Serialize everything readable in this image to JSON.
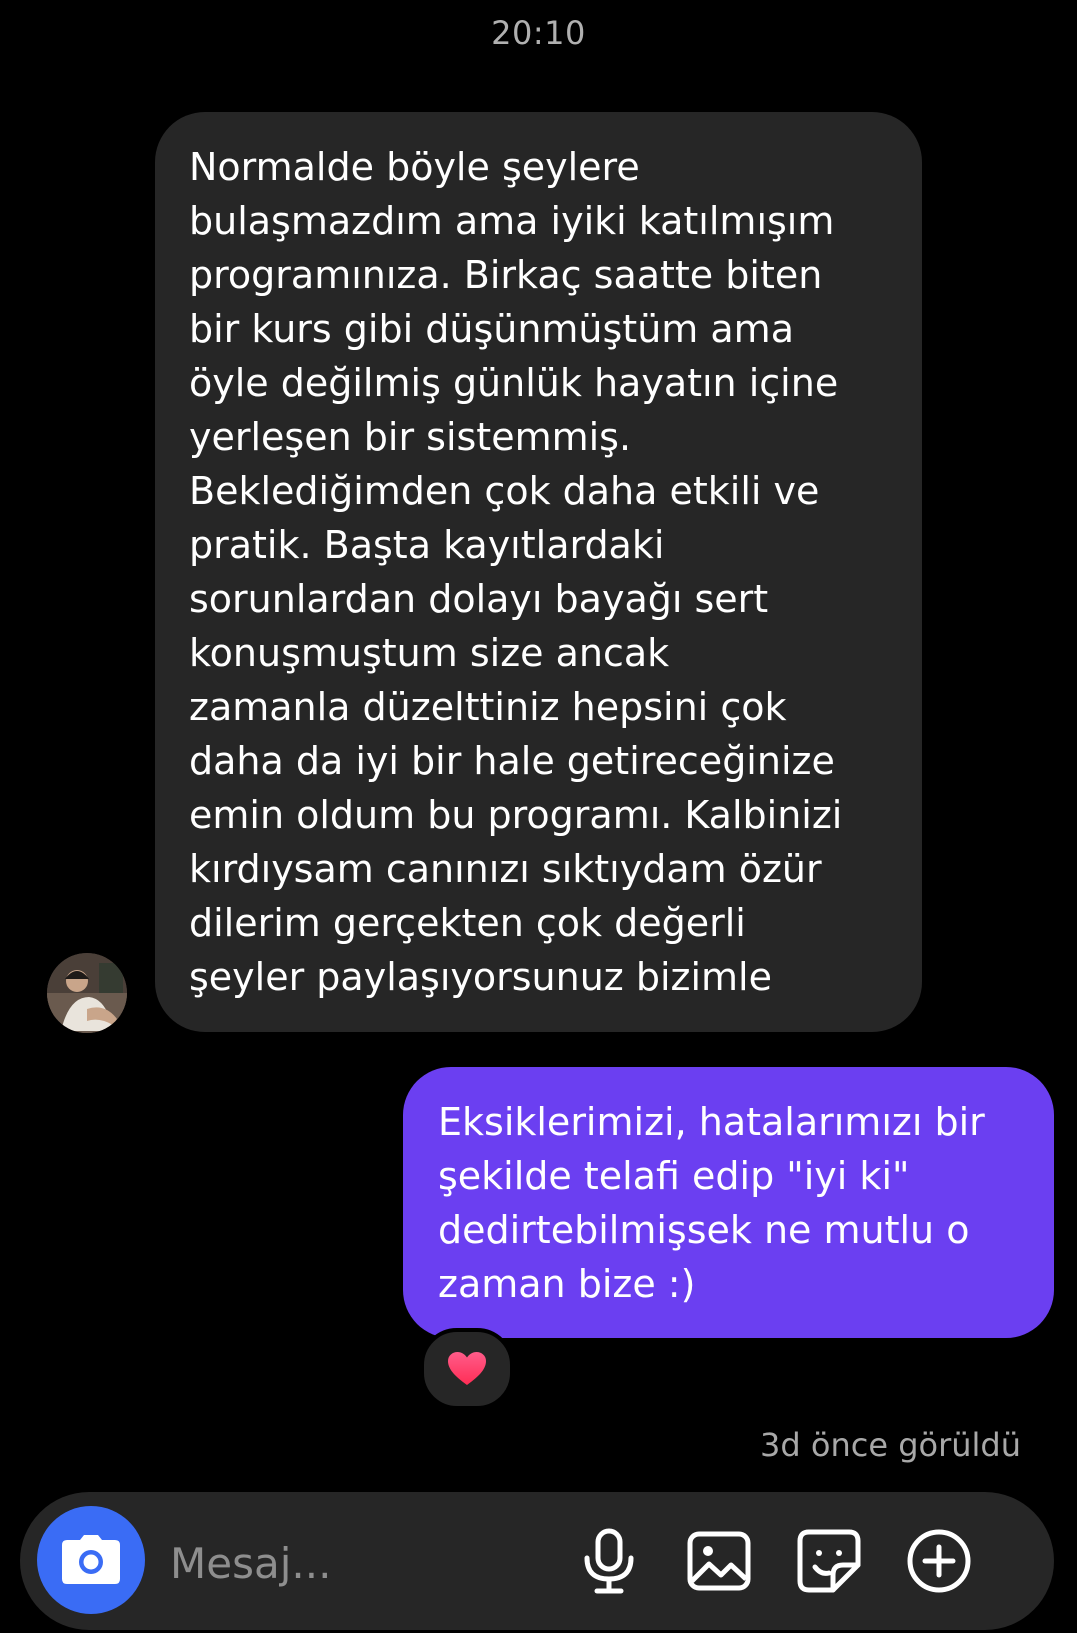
{
  "header": {
    "time": "20:10"
  },
  "messages": {
    "incoming": {
      "text": "Normalde böyle şeylere bulaşmazdım ama iyiki katılmışım programınıza. Birkaç saatte biten bir kurs gibi düşünmüştüm ama öyle değilmiş günlük hayatın içine yerleşen bir sistemmiş. Beklediğimden çok daha etkili ve pratik. Başta kayıtlardaki sorunlardan dolayı bayağı sert konuşmuştum size ancak zamanla düzelttiniz hepsini çok daha da iyi bir hale getireceğinize emin oldum bu programı. Kalbinizi kırdıysam canınızı sıktıydam özür dilerim gerçekten çok değerli şeyler paylaşıyorsunuz bizimle",
      "lines": [
        "Normalde böyle şeylere",
        "bulaşmazdım ama iyiki katılmışım",
        "programınıza. Birkaç saatte biten",
        "bir kurs gibi düşünmüştüm ama",
        "öyle değilmiş günlük hayatın içine",
        "yerleşen bir sistemmiş.",
        "Beklediğimden çok daha etkili ve",
        "pratik. Başta kayıtlardaki",
        "sorunlardan dolayı bayağı sert",
        "konuşmuştum size ancak",
        "zamanla düzelttiniz hepsini çok",
        "daha da iyi bir hale getireceğinize",
        "emin oldum bu programı. Kalbinizi",
        "kırdıysam canınızı sıktıydam özür",
        "dilerim gerçekten çok değerli",
        "şeyler paylaşıyorsunuz bizimle"
      ]
    },
    "outgoing": {
      "lines": [
        "Eksiklerimizi, hatalarımızı bir",
        "şekilde telafi edip \"iyi ki\"",
        "dedirtebilmişsek ne mutlu o",
        "zaman bize :)"
      ],
      "reaction": "heart-icon"
    }
  },
  "status": {
    "seen": "3d önce görüldü"
  },
  "composer": {
    "placeholder": "Mesaj...",
    "icons": [
      "camera-icon",
      "microphone-icon",
      "image-icon",
      "sticker-icon",
      "plus-icon"
    ]
  },
  "colors": {
    "background": "#000000",
    "incoming_bubble": "#262626",
    "outgoing_bubble": "#6b3ff1",
    "camera_button": "#3a6cf5",
    "heart": "#ff2d55"
  }
}
